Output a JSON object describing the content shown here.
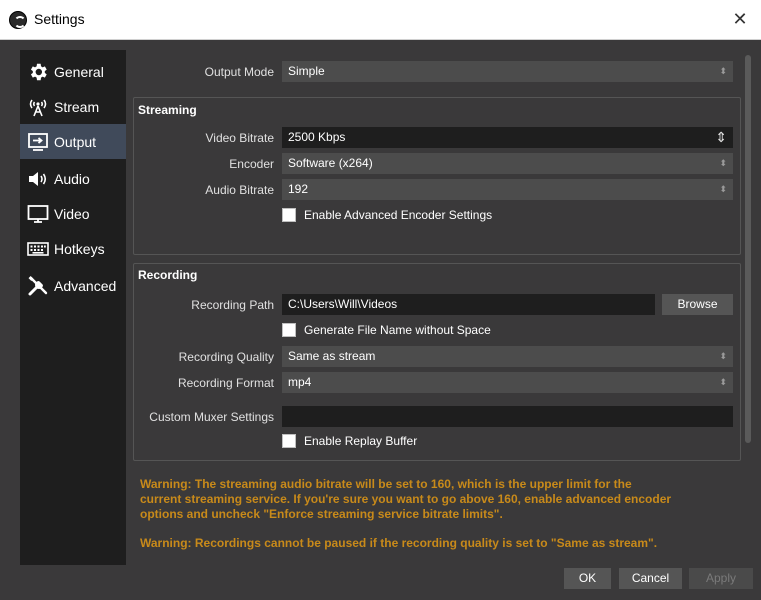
{
  "window": {
    "title": "Settings"
  },
  "sidebar": {
    "items": [
      {
        "label": "General",
        "icon": "gear-icon",
        "active": false
      },
      {
        "label": "Stream",
        "icon": "broadcast-icon",
        "active": false
      },
      {
        "label": "Output",
        "icon": "output-icon",
        "active": true
      },
      {
        "label": "Audio",
        "icon": "speaker-icon",
        "active": false
      },
      {
        "label": "Video",
        "icon": "monitor-icon",
        "active": false
      },
      {
        "label": "Hotkeys",
        "icon": "keyboard-icon",
        "active": false
      },
      {
        "label": "Advanced",
        "icon": "tools-icon",
        "active": false
      }
    ]
  },
  "output_mode": {
    "label": "Output Mode",
    "value": "Simple"
  },
  "streaming": {
    "title": "Streaming",
    "video_bitrate": {
      "label": "Video Bitrate",
      "value": "2500 Kbps"
    },
    "encoder": {
      "label": "Encoder",
      "value": "Software (x264)"
    },
    "audio_bitrate": {
      "label": "Audio Bitrate",
      "value": "192"
    },
    "advanced_encoder": {
      "label": "Enable Advanced Encoder Settings",
      "checked": false
    }
  },
  "recording": {
    "title": "Recording",
    "path": {
      "label": "Recording Path",
      "value": "C:\\Users\\Will\\Videos",
      "browse": "Browse"
    },
    "no_space": {
      "label": "Generate File Name without Space",
      "checked": false
    },
    "quality": {
      "label": "Recording Quality",
      "value": "Same as stream"
    },
    "format": {
      "label": "Recording Format",
      "value": "mp4"
    },
    "muxer": {
      "label": "Custom Muxer Settings",
      "value": ""
    },
    "replay_buffer": {
      "label": "Enable Replay Buffer",
      "checked": false
    }
  },
  "warnings": {
    "line1": "Warning: The streaming audio bitrate will be set to 160, which is the upper limit for the",
    "line2": "current streaming service. If you're sure you want to go above 160, enable advanced encoder",
    "line3": "options and uncheck \"Enforce streaming service bitrate limits\".",
    "line4": "Warning: Recordings cannot be paused if the recording quality is set to \"Same as stream\"."
  },
  "buttons": {
    "ok": "OK",
    "cancel": "Cancel",
    "apply": "Apply"
  },
  "colors": {
    "window_bg": "#3a393a",
    "sidebar_bg": "#1e1e1e",
    "active_item": "#404a5a",
    "field_bg": "#4c4c4c",
    "warning": "#c88a1a"
  }
}
